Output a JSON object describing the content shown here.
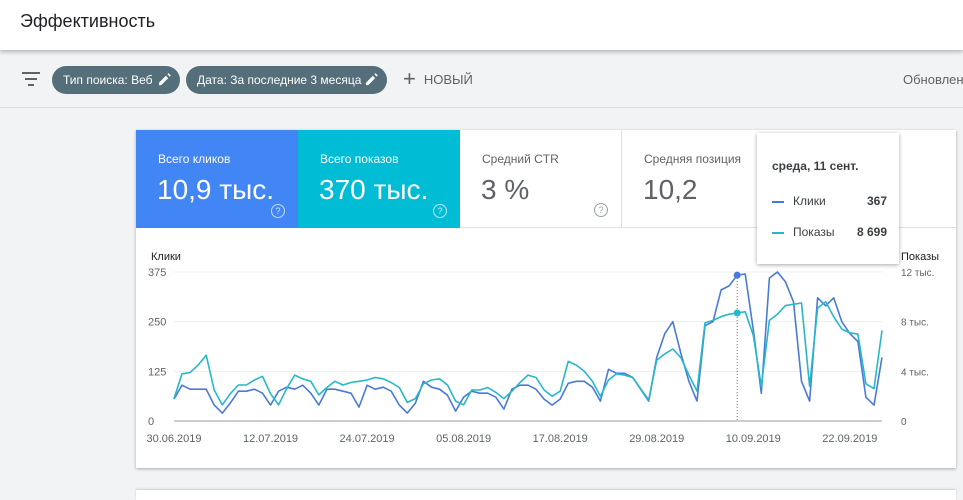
{
  "header": {
    "title": "Эффективность"
  },
  "filters": {
    "chips": [
      {
        "label": "Тип поиска: Веб"
      },
      {
        "label": "Дата: За последние 3 месяца"
      }
    ],
    "new_label": "НОВЫЙ",
    "updated_text": "Обновлен"
  },
  "metrics": [
    {
      "label": "Всего кликов",
      "value": "10,9 тыс.",
      "color": "#4285f4"
    },
    {
      "label": "Всего показов",
      "value": "370 тыс.",
      "color": "#00bcd4"
    },
    {
      "label": "Средний CTR",
      "value": "3 %"
    },
    {
      "label": "Средняя позиция",
      "value": "10,2"
    }
  ],
  "tooltip": {
    "date": "среда, 11 сент.",
    "rows": [
      {
        "name": "Клики",
        "value": "367"
      },
      {
        "name": "Показы",
        "value": "8 699"
      }
    ]
  },
  "chart_data": {
    "type": "line",
    "left_axis": {
      "label": "Клики",
      "ticks": [
        "375",
        "250",
        "125",
        "0"
      ],
      "range": [
        0,
        375
      ]
    },
    "right_axis": {
      "label": "Показы",
      "ticks": [
        "12 тыс.",
        "8 тыс.",
        "4 тыс.",
        "0"
      ],
      "range": [
        0,
        12000
      ]
    },
    "x_labels": [
      "30.06.2019",
      "12.07.2019",
      "24.07.2019",
      "05.08.2019",
      "17.08.2019",
      "29.08.2019",
      "10.09.2019",
      "22.09.2019"
    ],
    "x_dates": [
      "2019-06-30",
      "2019-07-12",
      "2019-07-24",
      "2019-08-05",
      "2019-08-17",
      "2019-08-29",
      "2019-09-10",
      "2019-09-22"
    ],
    "series": [
      {
        "name": "Клики",
        "color": "#4a7ad8",
        "axis": "left",
        "values": [
          55,
          90,
          80,
          80,
          80,
          40,
          20,
          45,
          75,
          75,
          80,
          70,
          40,
          75,
          85,
          80,
          90,
          70,
          40,
          80,
          80,
          75,
          70,
          35,
          90,
          80,
          85,
          75,
          40,
          20,
          45,
          100,
          85,
          80,
          65,
          25,
          60,
          75,
          70,
          70,
          60,
          30,
          80,
          90,
          90,
          80,
          55,
          40,
          55,
          95,
          100,
          100,
          85,
          50,
          130,
          120,
          120,
          110,
          80,
          50,
          160,
          220,
          250,
          170,
          100,
          50,
          240,
          250,
          330,
          340,
          367,
          370,
          230,
          70,
          360,
          375,
          350,
          300,
          100,
          50,
          310,
          290,
          310,
          250,
          220,
          200,
          60,
          40,
          160
        ]
      },
      {
        "name": "Показы",
        "color": "#26b8c9",
        "axis": "right",
        "values": [
          1800,
          3800,
          3900,
          4500,
          5300,
          2500,
          1300,
          2200,
          2900,
          2900,
          3300,
          3600,
          2200,
          1300,
          2600,
          3700,
          3400,
          3200,
          2100,
          2700,
          3200,
          2900,
          3100,
          3200,
          3300,
          3500,
          3400,
          3100,
          2700,
          1500,
          1800,
          3000,
          3300,
          3400,
          2900,
          1600,
          1300,
          2500,
          2500,
          2700,
          2300,
          1800,
          2400,
          3100,
          3700,
          3500,
          2500,
          2000,
          2400,
          4800,
          4500,
          4000,
          3200,
          2000,
          3300,
          3800,
          3700,
          3500,
          2600,
          1700,
          4900,
          5400,
          5800,
          5100,
          3700,
          2400,
          7900,
          8100,
          8400,
          8600,
          8699,
          8800,
          6900,
          2800,
          8100,
          8600,
          9300,
          9400,
          9500,
          2800,
          9100,
          9600,
          8400,
          7400,
          7100,
          7000,
          3000,
          2600,
          7300
        ]
      }
    ],
    "highlight": {
      "series_index_point": 70,
      "date_label": "среда, 11 сент.",
      "clicks": 367,
      "impressions": 8699
    }
  }
}
